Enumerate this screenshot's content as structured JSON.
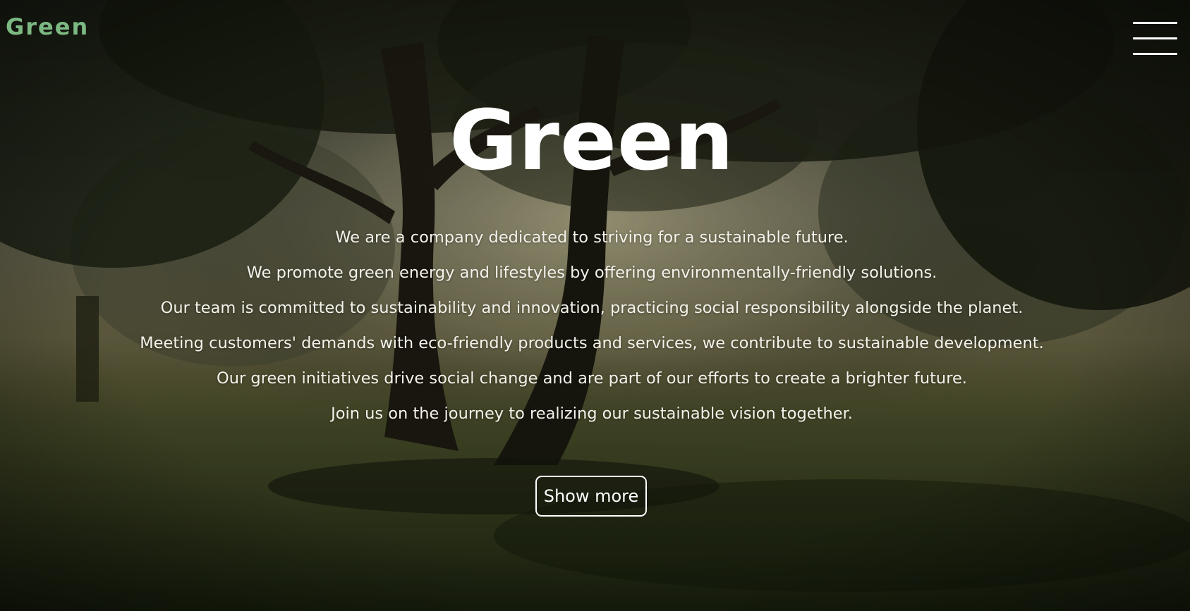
{
  "header": {
    "logo_text": "Green",
    "menu_icon": "hamburger-menu-icon"
  },
  "hero": {
    "title": "Green",
    "lines": [
      "We are a company dedicated to striving for a sustainable future.",
      "We promote green energy and lifestyles by offering environmentally-friendly solutions.",
      "Our team is committed to sustainability and innovation, practicing social responsibility alongside the planet.",
      "Meeting customers' demands with eco-friendly products and services, we contribute to sustainable development.",
      "Our green initiatives drive social change and are part of our efforts to create a brighter future.",
      "Join us on the journey to realizing our sustainable vision together."
    ],
    "button_label": "Show more"
  },
  "colors": {
    "logo": "#7cb982",
    "text": "#ffffff",
    "button_border": "#ffffff"
  }
}
